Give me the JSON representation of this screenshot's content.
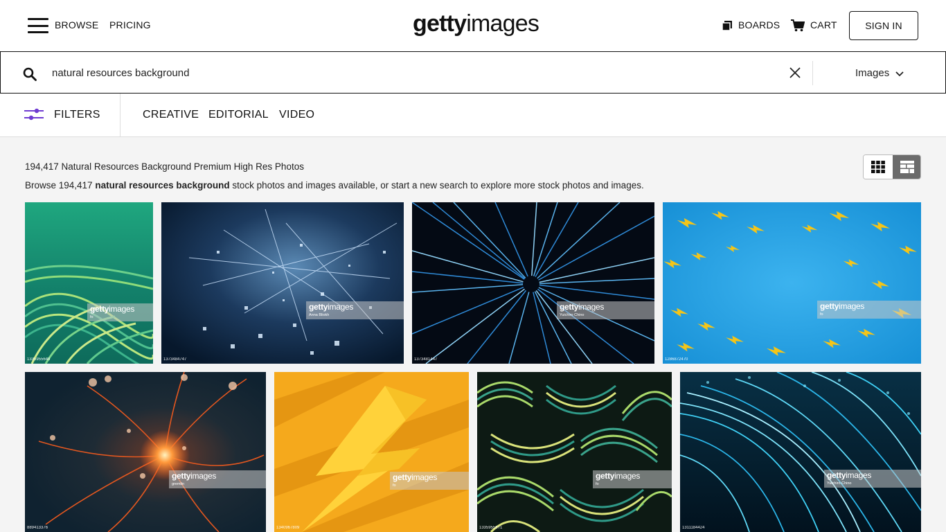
{
  "header": {
    "browse_label": "BROWSE",
    "pricing_label": "PRICING",
    "logo_bold": "getty",
    "logo_light": "images",
    "boards_label": "BOARDS",
    "cart_label": "CART",
    "signin_label": "SIGN IN"
  },
  "search": {
    "query": "natural resources background",
    "type_label": "Images"
  },
  "filters": {
    "filters_label": "FILTERS",
    "tabs": [
      {
        "label": "CREATIVE"
      },
      {
        "label": "EDITORIAL"
      },
      {
        "label": "VIDEO"
      }
    ]
  },
  "results": {
    "title": "194,417 Natural Resources Background Premium High Res Photos",
    "desc_before": "Browse 194,417 ",
    "desc_bold": "natural resources background",
    "desc_after": " stock photos and images available, or start a new search to explore more stock photos and images."
  },
  "watermark": {
    "logo_bold": "getty",
    "logo_light": "images"
  },
  "tiles": [
    {
      "id": "1335955648",
      "credit": "fo",
      "icon": "green-wave-pattern"
    },
    {
      "id": "1373484747",
      "credit": "Anna Bliokh",
      "icon": "blue-digital-particles"
    },
    {
      "id": "1373481447",
      "credit": "Yuichiro Chino",
      "icon": "blue-light-burst"
    },
    {
      "id": "1286872470",
      "credit": "fo",
      "icon": "lightning-bolt-pattern"
    },
    {
      "id": "889413376",
      "credit": "gremlin",
      "icon": "orange-neuron"
    },
    {
      "id": "1340967809",
      "credit": "fo",
      "icon": "yellow-lightning-bolt"
    },
    {
      "id": "1335955671",
      "credit": "fo",
      "icon": "green-weave-pattern"
    },
    {
      "id": "1311184424",
      "credit": "Yuichiro Chino",
      "icon": "blue-fiber-optic"
    }
  ],
  "colors": {
    "accent": "#6e3bd1",
    "tile_teal": "#1a9c7a",
    "tile_blue": "#1b9ad8",
    "tile_orange": "#f3a11a"
  }
}
